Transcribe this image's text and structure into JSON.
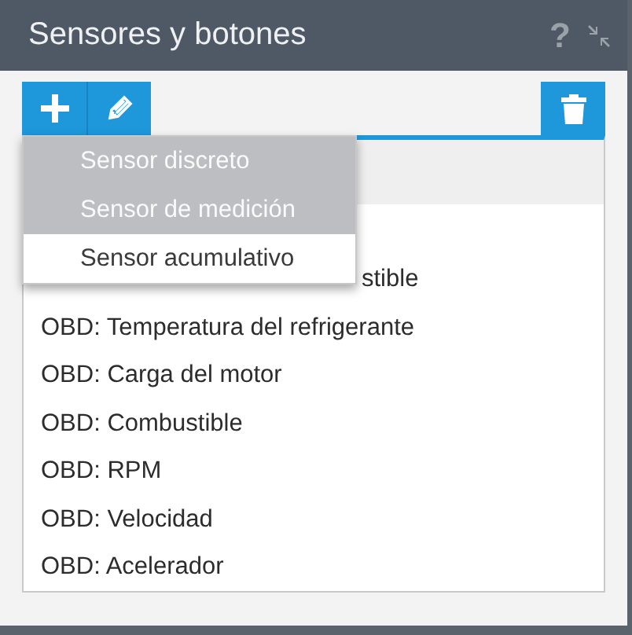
{
  "window": {
    "title": "Sensores y botones",
    "help_icon": "?"
  },
  "add_menu": {
    "items": [
      {
        "label": "Sensor discreto",
        "highlighted": true
      },
      {
        "label": "Sensor de medición",
        "highlighted": true
      },
      {
        "label": "Sensor acumulativo",
        "highlighted": false
      }
    ]
  },
  "sensors": [
    {
      "label": "stible",
      "kind": "covered"
    },
    {
      "label": "OBD: Temperatura del refrigerante",
      "kind": "plain"
    },
    {
      "label": "OBD: Carga del motor",
      "kind": "plain"
    },
    {
      "label": "OBD: Combustible",
      "kind": "plain"
    },
    {
      "label": "OBD: RPM",
      "kind": "plain"
    },
    {
      "label": "OBD: Velocidad",
      "kind": "plain"
    },
    {
      "label": "OBD: Acelerador",
      "kind": "plain"
    }
  ]
}
